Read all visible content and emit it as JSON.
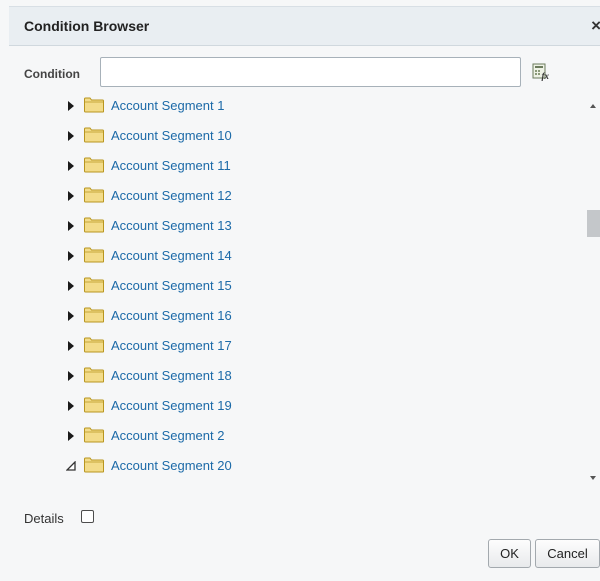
{
  "dialog": {
    "title": "Condition Browser",
    "close_glyph": "×"
  },
  "condition": {
    "label": "Condition",
    "value": "",
    "expression_icon": "fx-expression-builder-icon"
  },
  "tree": {
    "items": [
      {
        "label": "Account Segment 1",
        "expanded": false
      },
      {
        "label": "Account Segment 10",
        "expanded": false
      },
      {
        "label": "Account Segment 11",
        "expanded": false
      },
      {
        "label": "Account Segment 12",
        "expanded": false
      },
      {
        "label": "Account Segment 13",
        "expanded": false
      },
      {
        "label": "Account Segment 14",
        "expanded": false
      },
      {
        "label": "Account Segment 15",
        "expanded": false
      },
      {
        "label": "Account Segment 16",
        "expanded": false
      },
      {
        "label": "Account Segment 17",
        "expanded": false
      },
      {
        "label": "Account Segment 18",
        "expanded": false
      },
      {
        "label": "Account Segment 19",
        "expanded": false
      },
      {
        "label": "Account Segment 2",
        "expanded": false
      },
      {
        "label": "Account Segment 20",
        "expanded": true
      }
    ]
  },
  "details": {
    "label": "Details",
    "checked": false
  },
  "buttons": {
    "ok": "OK",
    "cancel": "Cancel"
  },
  "colors": {
    "link": "#1c6aa8",
    "folder_fill": "#f3dc8a",
    "folder_stroke": "#b8961f",
    "titlebar_bg": "#e9eef2"
  }
}
